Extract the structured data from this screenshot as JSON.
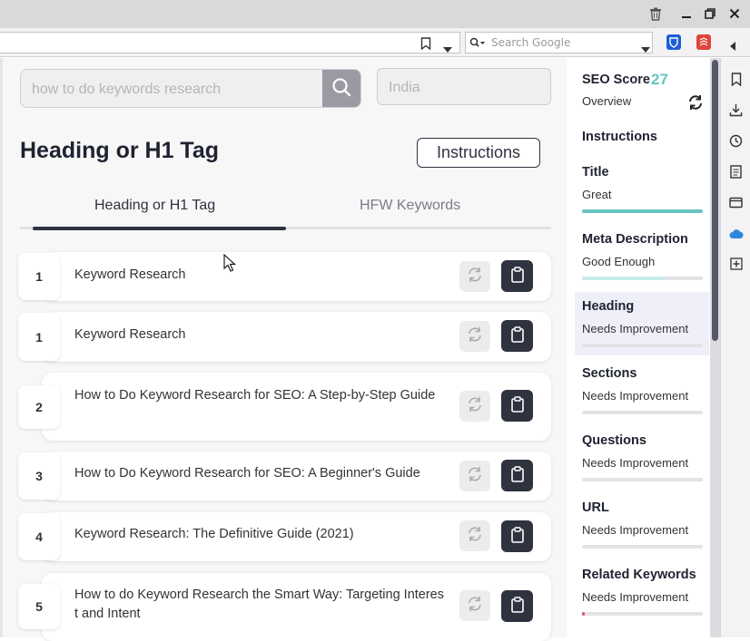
{
  "browser": {
    "search_placeholder": "Search Google"
  },
  "tool": {
    "keyword_placeholder": "how to do keywords research",
    "country_placeholder": "India",
    "page_title": "Heading or H1 Tag",
    "instructions_button": "Instructions",
    "tabs": [
      {
        "label": "Heading or H1 Tag",
        "active": true
      },
      {
        "label": "HFW Keywords",
        "active": false
      }
    ],
    "rows": [
      {
        "rank": "1",
        "text": "Keyword Research"
      },
      {
        "rank": "1",
        "text": "Keyword Research"
      },
      {
        "rank": "2",
        "text": "How to Do Keyword Research for SEO: A Step-by-Step Guide"
      },
      {
        "rank": "3",
        "text": "How to Do Keyword Research for SEO: A Beginner's Guide"
      },
      {
        "rank": "4",
        "text": "Keyword Research: The Definitive Guide (2021)"
      },
      {
        "rank": "5",
        "text": "How to do Keyword Research the Smart Way: Targeting Interest and Intent"
      }
    ]
  },
  "sidebar": {
    "seo_score_label": "SEO Score",
    "seo_score_value": "27",
    "overview": "Overview",
    "instructions": "Instructions",
    "sections": [
      {
        "name": "Title",
        "status": "Great",
        "progress": 1.0,
        "color": "#67c5c1"
      },
      {
        "name": "Meta Description",
        "status": "Good Enough",
        "progress": 0.68,
        "color": "#c7ecea"
      },
      {
        "name": "Heading",
        "status": "Needs Improvement",
        "progress": 0.0,
        "color": "#e3e3e6"
      },
      {
        "name": "Sections",
        "status": "Needs Improvement",
        "progress": 0.0,
        "color": "#e3e3e6"
      },
      {
        "name": "Questions",
        "status": "Needs Improvement",
        "progress": 0.0,
        "color": "#e3e3e6"
      },
      {
        "name": "URL",
        "status": "Needs Improvement",
        "progress": 0.0,
        "color": "#e3e3e6"
      },
      {
        "name": "Related Keywords",
        "status": "Needs Improvement",
        "progress": 0.02,
        "color": "#e2506a"
      }
    ]
  },
  "colors": {
    "accent_dark": "#2f3340",
    "score_teal": "#67c5c1"
  }
}
